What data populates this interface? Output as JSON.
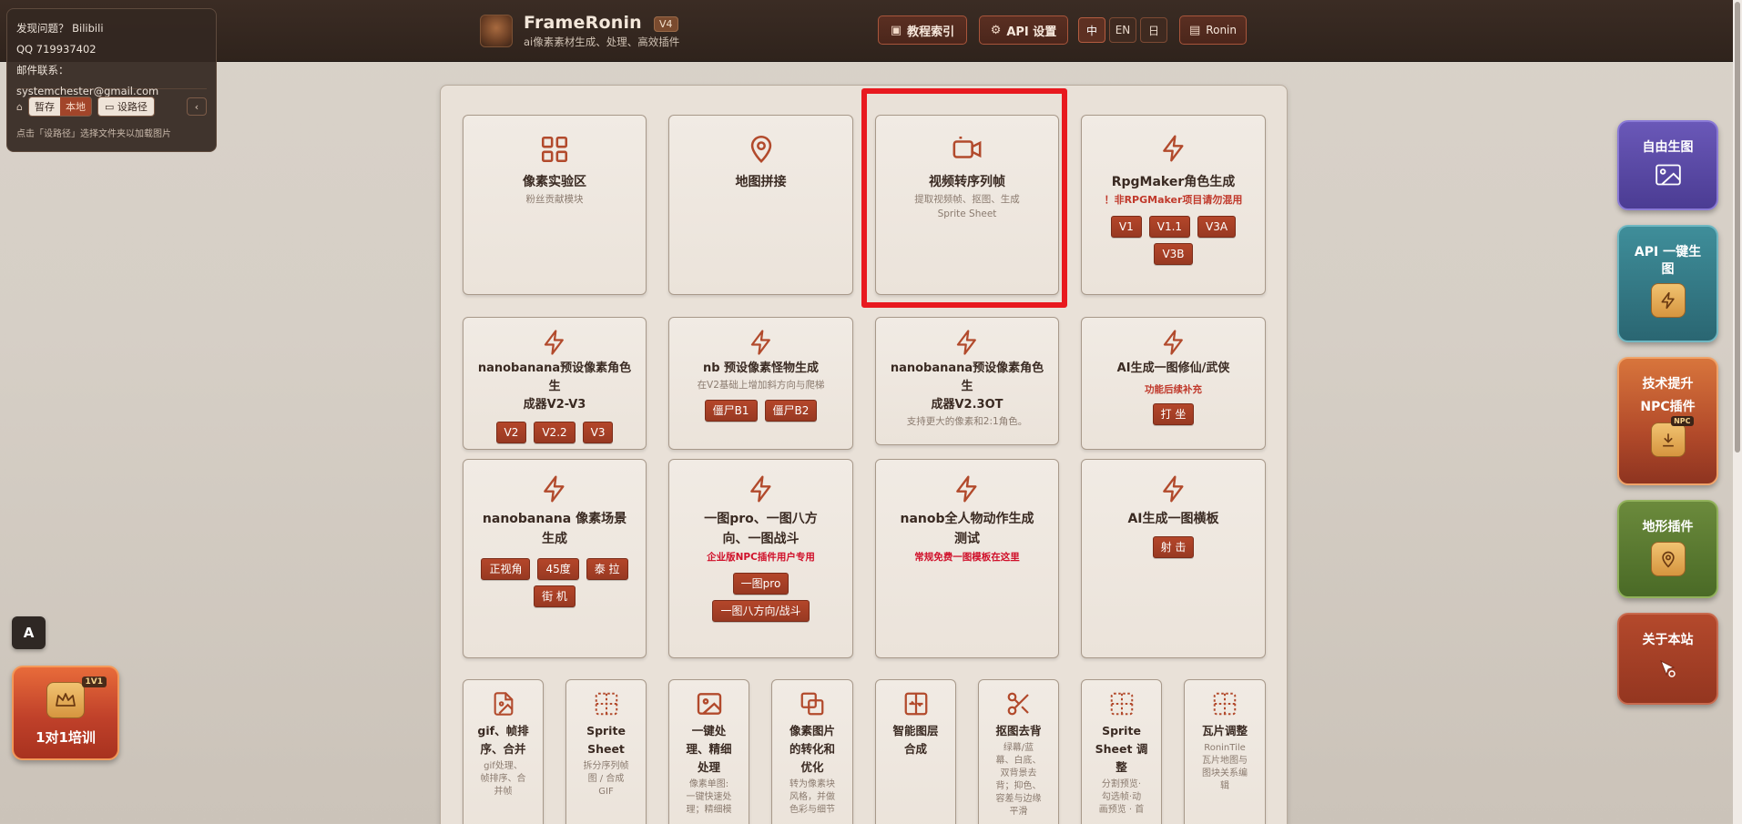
{
  "header": {
    "brand_title": "FrameRonin",
    "brand_version": "V4",
    "brand_subtitle": "ai像素素材生成、处理、高效插件",
    "tutorial_label": "教程索引",
    "api_label": "API 设置",
    "langs": [
      "中",
      "EN",
      "日"
    ],
    "user_label": "Ronin"
  },
  "info": {
    "issue": "发现问题？  Bilibili",
    "qq": "QQ 719937402",
    "email": "邮件联系：systemchester@gmail.com",
    "save_label": "暂存",
    "local_label": "本地",
    "path_label": "设路径",
    "hint": "点击「设路径」选择文件夹以加载图片"
  },
  "cards": {
    "c1": {
      "title": "像素实验区",
      "sub": "粉丝贡献模块"
    },
    "c2": {
      "title": "地图拼接"
    },
    "c3": {
      "title": "视频转序列帧",
      "sub1": "提取视频帧、抠图、生成",
      "sub2": "Sprite Sheet"
    },
    "c4": {
      "title": "RpgMaker角色生成",
      "warn": "！非RPGMaker项目请勿混用",
      "tags": [
        "V1",
        "V1.1",
        "V3A",
        "V3B"
      ]
    },
    "c5": {
      "title1": "nanobanana预设像素角色生",
      "title2": "成器V2-V3",
      "tags": [
        "V2",
        "V2.2",
        "V3"
      ]
    },
    "c6": {
      "title": "nb 预设像素怪物生成",
      "sub": "在V2基础上增加斜方向与爬梯",
      "tags": [
        "僵尸B1",
        "僵尸B2"
      ]
    },
    "c7": {
      "title1": "nanobanana预设像素角色生",
      "title2": "成器V2.3OT",
      "sub": "支持更大的像素和2:1角色。"
    },
    "c8": {
      "title": "AI生成一图修仙/武侠",
      "warn": "功能后续补充",
      "tags": [
        "打 坐"
      ]
    },
    "c9": {
      "title1": "nanobanana 像素场景",
      "title2": "生成",
      "tags": [
        "正视角",
        "45度",
        "泰 拉",
        "街 机"
      ]
    },
    "c10": {
      "title1": "一图pro、一图八方",
      "title2": "向、一图战斗",
      "warn": "企业版NPC插件用户专用",
      "tags": [
        "一图pro",
        "一图八方向/战斗"
      ]
    },
    "c11": {
      "title1": "nanob全人物动作生成",
      "title2": "测试",
      "warn": "常规免费一图模板在这里"
    },
    "c12": {
      "title": "AI生成一图横板",
      "tags": [
        "射 击"
      ]
    }
  },
  "small_cards": [
    {
      "t1": "gif、帧排",
      "t2": "序、合并",
      "s1": "gif处理、",
      "s2": "帧排序、合",
      "s3": "并帧"
    },
    {
      "t1": "Sprite",
      "t2": "Sheet",
      "s1": "拆分序列帧",
      "s2": "图 / 合成",
      "s3": "GIF"
    },
    {
      "t1": "一键处",
      "t2": "理、精细",
      "t3": "处理",
      "s1": "像素单图:",
      "s2": "一键快速处",
      "s3": "理；精细模"
    },
    {
      "t1": "像素图片",
      "t2": "的转化和",
      "t3": "优化",
      "s1": "转为像素块",
      "s2": "风格，并做",
      "s3": "色彩与细节"
    },
    {
      "t1": "智能图层",
      "t2": "合成"
    },
    {
      "t1": "抠图去背",
      "s1": "绿幕/蓝",
      "s2": "幕、白底、",
      "s3": "双背景去",
      "s4": "背；抑色、",
      "s5": "容差与边缘",
      "s6": "平滑"
    },
    {
      "t1": "Sprite",
      "t2": "Sheet 调",
      "t3": "整",
      "s1": "分割预览·",
      "s2": "勾选帧·动",
      "s3": "画预览 · 首"
    },
    {
      "t1": "瓦片调整",
      "s1": "RoninTile",
      "s2": "瓦片地图与",
      "s3": "图块关系编",
      "s4": "辑"
    }
  ],
  "side": {
    "free": "自由生图",
    "api1": "API 一键生",
    "api2": "图",
    "npc1": "技术提升",
    "npc2": "NPC插件",
    "npc_badge": "NPC",
    "terrain": "地形插件",
    "about": "关于本站"
  },
  "bottom_left": {
    "a": "A",
    "training": "1对1培训",
    "training_badge": "1V1"
  }
}
